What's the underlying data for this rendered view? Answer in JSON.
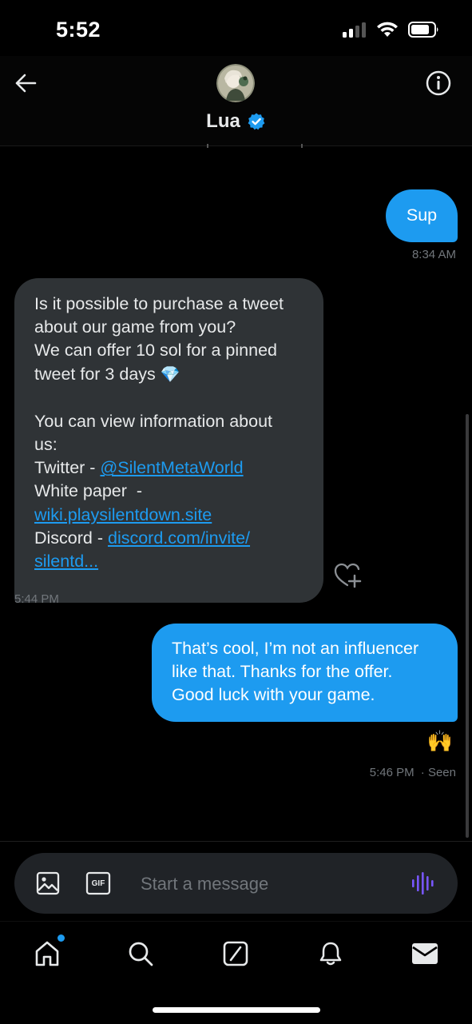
{
  "status": {
    "time": "5:52"
  },
  "header": {
    "contact_name": "Lua",
    "verified": true
  },
  "messages": [
    {
      "direction": "out",
      "text": "Sup",
      "time": "8:34 AM"
    },
    {
      "direction": "in",
      "lines": [
        "Is it possible to purchase a tweet",
        "about our game from you?",
        "We can offer 10 sol for a pinned",
        "tweet for 3 days",
        "You can view information about",
        "us:"
      ],
      "emoji": "💎",
      "twitter_label": "Twitter - ",
      "twitter_link": "@SilentMetaWorld",
      "whitepaper_label": "White paper  -",
      "whitepaper_link": "wiki.playsilentdown.site",
      "discord_label": "Discord - ",
      "discord_link_1": "discord.com/invite/",
      "discord_link_2": "silentd...",
      "time": "5:44 PM"
    },
    {
      "direction": "out",
      "lines": [
        "That’s cool, I’m not an influencer",
        "like that. Thanks for the offer.",
        "Good luck with your game."
      ],
      "reaction": "🙌",
      "time": "5:46 PM",
      "status": "· Seen"
    }
  ],
  "composer": {
    "placeholder": "Start a message",
    "gif_label": "GIF"
  },
  "tabs": [
    "home-icon",
    "search-icon",
    "grok-icon",
    "bell-icon",
    "mail-icon"
  ],
  "colors": {
    "accent": "#1d9bf0",
    "incoming_bubble": "#2f3336",
    "background": "#000000",
    "voice": "#7856ff"
  }
}
